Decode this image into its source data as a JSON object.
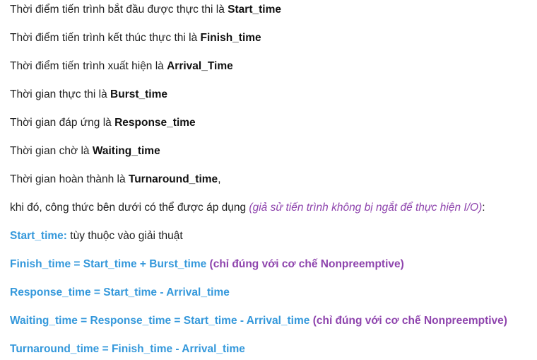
{
  "definitions": [
    {
      "text": "Thời điểm tiến trình bắt đầu được thực thi là ",
      "term": "Start_time",
      "suffix": ""
    },
    {
      "text": "Thời điểm tiến trình kết thúc thực thi là ",
      "term": "Finish_time",
      "suffix": ""
    },
    {
      "text": "Thời điểm tiến trình xuất hiện là ",
      "term": "Arrival_Time",
      "suffix": ""
    },
    {
      "text": "Thời gian thực thi là ",
      "term": "Burst_time",
      "suffix": ""
    },
    {
      "text": "Thời gian đáp ứng là ",
      "term": "Response_time",
      "suffix": ""
    },
    {
      "text": "Thời gian chờ là ",
      "term": "Waiting_time",
      "suffix": ""
    },
    {
      "text": "Thời gian hoàn thành là ",
      "term": "Turnaround_time",
      "suffix": ","
    }
  ],
  "intro": {
    "text": "khi đó, công thức bên dưới có thể được áp dụng ",
    "note": "(giả sử tiến trình không bị ngắt để thực hiện I/O)",
    "suffix": ":"
  },
  "formulas": [
    {
      "formula": "Start_time:",
      "plain": " tùy thuộc vào giải thuật",
      "note": ""
    },
    {
      "formula": "Finish_time = Start_time + Burst_time",
      "plain": "",
      "note": " (chỉ đúng với cơ chế Nonpreemptive)"
    },
    {
      "formula": "Response_time = Start_time - Arrival_time",
      "plain": "",
      "note": ""
    },
    {
      "formula": "Waiting_time = Response_time = Start_time - Arrival_time",
      "plain": "",
      "note": " (chỉ đúng với cơ chế Nonpreemptive)"
    },
    {
      "formula": "Turnaround_time = Finish_time - Arrival_time",
      "plain": "",
      "note": ""
    }
  ],
  "colors": {
    "formula": "#3498db",
    "note": "#8e44ad",
    "text": "#1f1f1f"
  }
}
